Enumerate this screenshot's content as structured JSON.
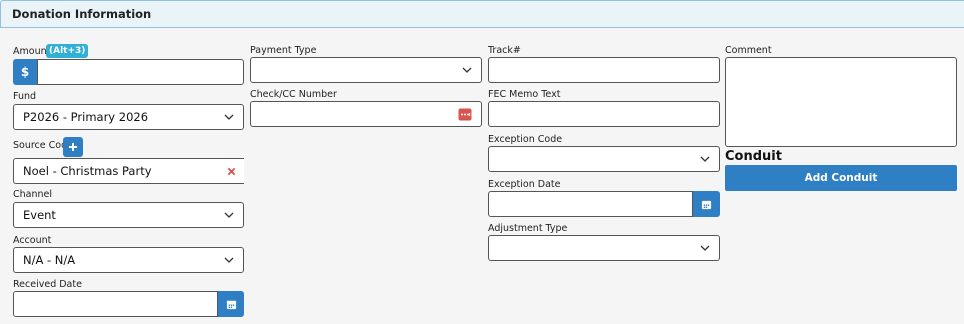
{
  "panel": {
    "title": "Donation Information"
  },
  "amount": {
    "label": "Amount",
    "shortcut": "(Alt+3)",
    "currency_symbol": "$",
    "value": ""
  },
  "fund": {
    "label": "Fund",
    "value": "P2026 - Primary 2026"
  },
  "source_code": {
    "label": "Source Code",
    "value": "Noel - Christmas Party"
  },
  "channel": {
    "label": "Channel",
    "value": "Event"
  },
  "account": {
    "label": "Account",
    "value": "N/A - N/A"
  },
  "received_date": {
    "label": "Received Date",
    "value": ""
  },
  "payment_type": {
    "label": "Payment Type",
    "value": ""
  },
  "check_cc_number": {
    "label": "Check/CC Number",
    "value": ""
  },
  "track": {
    "label": "Track#",
    "value": ""
  },
  "fec_memo_text": {
    "label": "FEC Memo Text",
    "value": ""
  },
  "exception_code": {
    "label": "Exception Code",
    "value": ""
  },
  "exception_date": {
    "label": "Exception Date",
    "value": ""
  },
  "adjustment_type": {
    "label": "Adjustment Type",
    "value": ""
  },
  "comment": {
    "label": "Comment",
    "value": ""
  },
  "conduit": {
    "heading": "Conduit",
    "add_button": "Add Conduit"
  },
  "colors": {
    "accent": "#2f7fc4",
    "badge": "#31b0d5",
    "danger": "#d9534f",
    "header_bg": "#e9f3f8"
  }
}
